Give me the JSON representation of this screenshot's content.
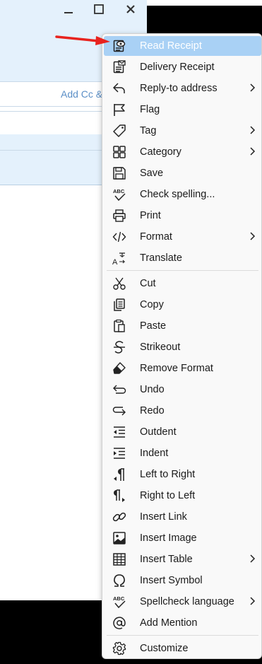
{
  "window": {
    "cc_link": "Add Cc &"
  },
  "menu": {
    "items": [
      {
        "label": "Read Receipt",
        "icon": "read-receipt-icon"
      },
      {
        "label": "Delivery Receipt",
        "icon": "delivery-receipt-icon"
      },
      {
        "label": "Reply-to address",
        "icon": "reply-icon"
      },
      {
        "label": "Flag",
        "icon": "flag-icon"
      },
      {
        "label": "Tag",
        "icon": "tag-icon"
      },
      {
        "label": "Category",
        "icon": "category-icon"
      },
      {
        "label": "Save",
        "icon": "save-icon"
      },
      {
        "label": "Check spelling...",
        "icon": "spellcheck-icon"
      },
      {
        "label": "Print",
        "icon": "print-icon"
      },
      {
        "label": "Format",
        "icon": "format-code-icon"
      },
      {
        "label": "Translate",
        "icon": "translate-icon"
      },
      {
        "label": "Cut",
        "icon": "scissors-icon"
      },
      {
        "label": "Copy",
        "icon": "copy-icon"
      },
      {
        "label": "Paste",
        "icon": "paste-icon"
      },
      {
        "label": "Strikeout",
        "icon": "strikeout-icon"
      },
      {
        "label": "Remove Format",
        "icon": "eraser-icon"
      },
      {
        "label": "Undo",
        "icon": "undo-icon"
      },
      {
        "label": "Redo",
        "icon": "redo-icon"
      },
      {
        "label": "Outdent",
        "icon": "outdent-icon"
      },
      {
        "label": "Indent",
        "icon": "indent-icon"
      },
      {
        "label": "Left to Right",
        "icon": "ltr-icon"
      },
      {
        "label": "Right to Left",
        "icon": "rtl-icon"
      },
      {
        "label": "Insert Link",
        "icon": "link-icon"
      },
      {
        "label": "Insert Image",
        "icon": "image-icon"
      },
      {
        "label": "Insert Table",
        "icon": "table-icon"
      },
      {
        "label": "Insert Symbol",
        "icon": "omega-icon"
      },
      {
        "label": "Spellcheck language",
        "icon": "spellcheck-language-icon"
      },
      {
        "label": "Add Mention",
        "icon": "at-icon"
      },
      {
        "label": "Customize",
        "icon": "gear-icon"
      }
    ],
    "highlighted_index": 0
  },
  "colors": {
    "highlight": "#a9d1f5",
    "header_bg": "#e4f1fc",
    "annotation_arrow": "#e8231e"
  }
}
